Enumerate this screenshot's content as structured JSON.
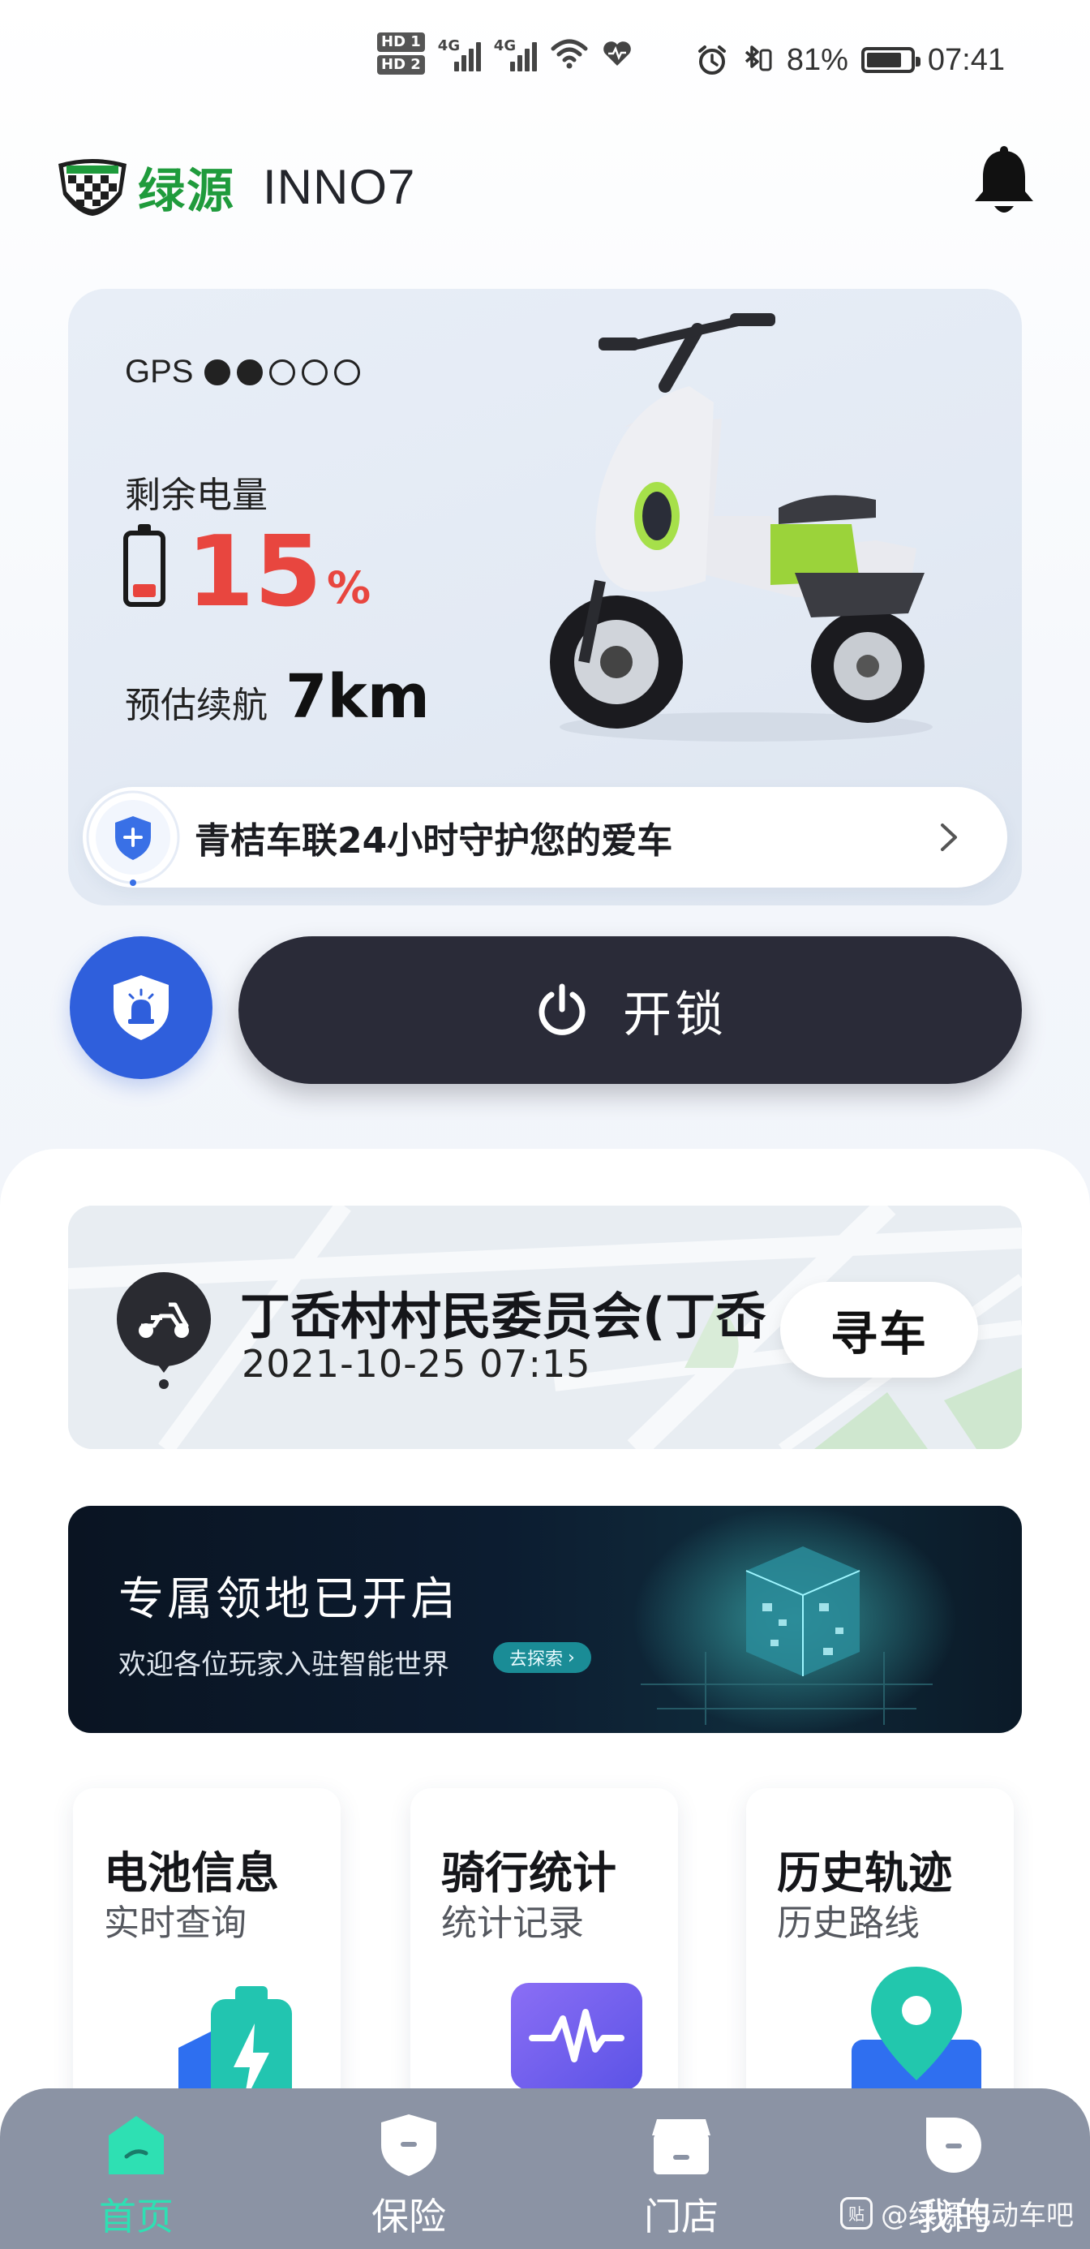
{
  "status_bar": {
    "hd1": "HD 1",
    "hd2": "HD 2",
    "net1": "4G",
    "net2": "4G",
    "battery_percent": "81%",
    "time": "07:41",
    "icons": [
      "signal-icon",
      "wifi-icon",
      "heart-icon",
      "alarm-icon",
      "bluetooth-icon",
      "battery-icon"
    ]
  },
  "header": {
    "brand": "绿源",
    "model": "INNO7"
  },
  "vehicle": {
    "gps_label": "GPS",
    "gps_strength": 2,
    "gps_max": 5,
    "soc_label": "剩余电量",
    "soc_value": "15",
    "soc_unit": "%",
    "range_label": "预估续航",
    "range_value": "7km"
  },
  "guard_banner": {
    "text": "青桔车联24小时守护您的爱车"
  },
  "actions": {
    "unlock_label": "开锁"
  },
  "location": {
    "address": "丁岙村村民委员会(丁岙",
    "time": "2021-10-25 07:15",
    "find_label": "寻车"
  },
  "promo": {
    "title": "专属领地已开启",
    "subtitle": "欢迎各位玩家入驻智能世界",
    "cta": "去探索"
  },
  "features": [
    {
      "title": "电池信息",
      "subtitle": "实时查询",
      "icon": "battery-info-icon"
    },
    {
      "title": "骑行统计",
      "subtitle": "统计记录",
      "icon": "ride-stats-icon"
    },
    {
      "title": "历史轨迹",
      "subtitle": "历史路线",
      "icon": "history-track-icon"
    }
  ],
  "tabs": [
    {
      "label": "首页",
      "active": true
    },
    {
      "label": "保险",
      "active": false
    },
    {
      "label": "门店",
      "active": false
    },
    {
      "label": "我的",
      "active": false
    }
  ],
  "watermark": {
    "badge": "贴",
    "text": "@绿源电动车吧"
  },
  "colors": {
    "brand_green": "#1f9b3c",
    "soc_red": "#e8463f",
    "accent_blue": "#2f5fdc",
    "unlock_dark": "#2a2b38",
    "tab_active": "#2ee0b3"
  }
}
